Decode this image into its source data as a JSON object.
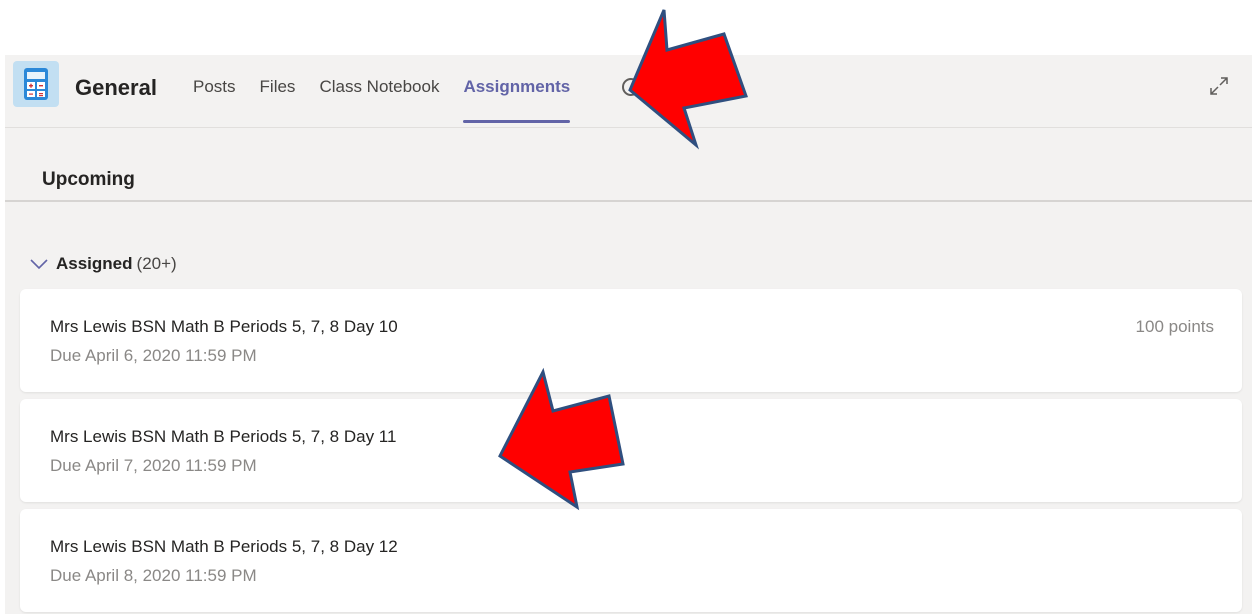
{
  "header": {
    "team_icon": "calculator-icon",
    "channel_title": "General",
    "tabs": [
      {
        "label": "Posts"
      },
      {
        "label": "Files"
      },
      {
        "label": "Class Notebook"
      },
      {
        "label": "Assignments",
        "active": true
      }
    ],
    "expand_icon": "expand-icon"
  },
  "upcoming": {
    "label": "Upcoming"
  },
  "assigned_group": {
    "label": "Assigned",
    "count": "(20+)",
    "items": [
      {
        "title": "Mrs Lewis BSN Math B Periods 5, 7, 8 Day 10",
        "due": "Due April 6, 2020 11:59 PM",
        "points": "100 points"
      },
      {
        "title": "Mrs Lewis BSN Math B Periods 5, 7, 8 Day 11",
        "due": "Due April 7, 2020 11:59 PM"
      },
      {
        "title": "Mrs Lewis BSN Math B Periods 5, 7, 8 Day 12",
        "due": "Due April 8, 2020 11:59 PM"
      }
    ]
  },
  "colors": {
    "accent": "#6264a7",
    "annotation_arrow_fill": "#ff0000",
    "annotation_arrow_stroke": "#2f4f7f"
  }
}
